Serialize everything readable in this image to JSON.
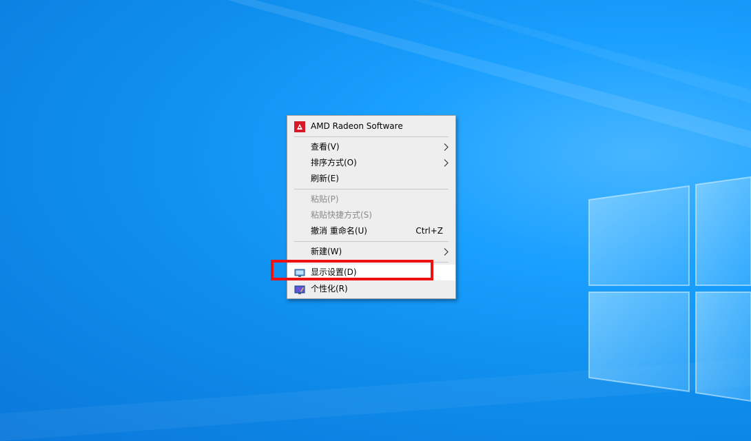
{
  "context_menu": {
    "items": [
      {
        "label": "AMD Radeon Software",
        "icon": "amd-radeon-icon",
        "enabled": true
      },
      {
        "label": "查看(V)",
        "submenu": true,
        "enabled": true
      },
      {
        "label": "排序方式(O)",
        "submenu": true,
        "enabled": true
      },
      {
        "label": "刷新(E)",
        "enabled": true
      },
      {
        "label": "粘贴(P)",
        "enabled": false
      },
      {
        "label": "粘贴快捷方式(S)",
        "enabled": false
      },
      {
        "label": "撤消 重命名(U)",
        "shortcut": "Ctrl+Z",
        "enabled": true
      },
      {
        "label": "新建(W)",
        "submenu": true,
        "enabled": true
      },
      {
        "label": "显示设置(D)",
        "icon": "display-settings-icon",
        "enabled": true,
        "highlighted": true
      },
      {
        "label": "个性化(R)",
        "icon": "personalize-icon",
        "enabled": true
      }
    ]
  },
  "colors": {
    "menu_background": "#eeeeee",
    "highlight_box": "#ee1111",
    "desktop_blue": "#0f8fee"
  }
}
